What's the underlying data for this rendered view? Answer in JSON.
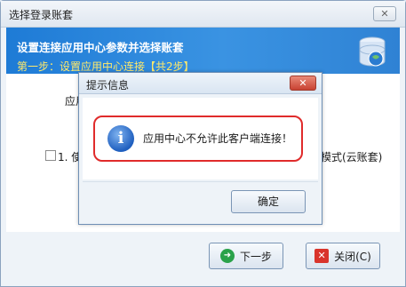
{
  "main_window": {
    "title": "选择登录账套",
    "close_glyph": "✕",
    "header_title": "设置连接应用中心参数并选择账套",
    "header_step": "第一步：设置应用中心连接【共2步】",
    "background_label": "应用",
    "checkbox_label": "1. 使",
    "right_text": "模式(云账套)",
    "next_button": "下一步",
    "next_icon": "➜",
    "close_button": "关闭(C)",
    "close_icon": "✕"
  },
  "dialog": {
    "title": "提示信息",
    "close_glyph": "✕",
    "icon_glyph": "i",
    "message": "应用中心不允许此客户端连接！",
    "ok_button": "确定"
  },
  "colors": {
    "header_blue": "#1e7bd6",
    "step_yellow": "#ffe96b",
    "highlight_red": "#e02b2b"
  }
}
